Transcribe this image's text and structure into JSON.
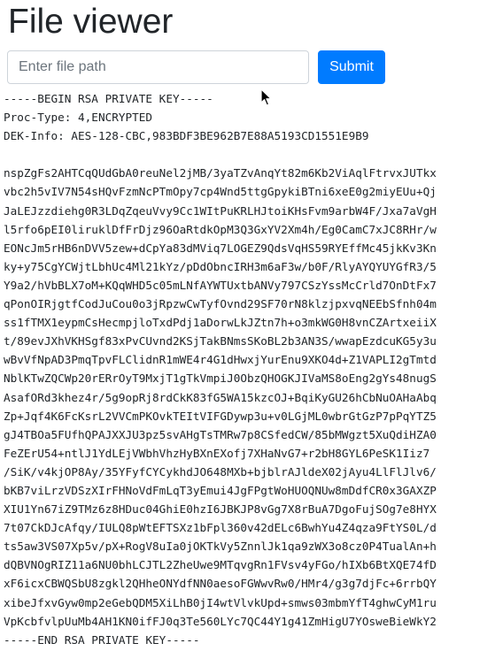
{
  "page": {
    "title": "File viewer"
  },
  "form": {
    "path_placeholder": "Enter file path",
    "path_value": "",
    "submit_label": "Submit"
  },
  "file": {
    "lines": [
      "-----BEGIN RSA PRIVATE KEY-----",
      "Proc-Type: 4,ENCRYPTED",
      "DEK-Info: AES-128-CBC,983BDF3BE962B7E88A5193CD1551E9B9",
      "",
      "nspZgFs2AHTCqQUdGbA0reuNel2jMB/3yaTZvAnqYt82m6Kb2ViAqlFtrvxJUTkx",
      "vbc2h5vIV7N54sHQvFzmNcPTmOpy7cp4Wnd5ttgGpykiBTni6xeE0g2miyEUu+Qj",
      "JaLEJzzdiehg0R3LDqZqeuVvy9Cc1WItPuKRLHJtoiKHsFvm9arbW4F/Jxa7aVgH",
      "l5rfo6pEI0liruklDfFrDjz96OaRtdkOpM3Q3GxYV2Xm4h/Eg0CamC7xJC8RHr/w",
      "EONcJm5rHB6nDVV5zew+dCpYa83dMViq7LOGEZ9QdsVqHS59RYEffMc45jkKv3Kn",
      "ky+y75CgYCWjtLbhUc4Ml21kYz/pDdObncIRH3m6aF3w/b0F/RlyAYQYUYGfR3/5",
      "Y9a2/hVbBLX7oM+KQqWHD5c05mLNfAYWTUxtbANVy797CSzYssMcCrld7OnDtFx7",
      "qPonOIRjgtfCodJuCou0o3jRpzwCwTyfOvnd29SF70rN8klzjpxvqNEEbSfnh04m",
      "ss1fTMX1eypmCsHecmpjloTxdPdj1aDorwLkJZtn7h+o3mkWG0H8vnCZArtxeiiX",
      "t/89evJXhVKHSgf83xPvCUvnd2KSjTakBNmsSKoBL2b3AN3S/wwapEzdcuKG5y3u",
      "wBvVfNpAD3PmqTpvFLClidnR1mWE4r4G1dHwxjYurEnu9XKO4d+Z1VAPLI2gTmtd",
      "NblKTwZQCWp20rERrOyT9MxjT1gTkVmpiJ0ObzQHOGKJIVaMS8oEng2gYs48nugS",
      "AsafORd3khez4r/5g9opRj8rdCkK83fG5WA15kzcOJ+BqiKyGU26hCbNuOAHaAbq",
      "Zp+Jqf4K6FcKsrL2VVCmPKOvkTEItVIFGDywp3u+v0LGjML0wbrGtGzP7pPqYTZ5",
      "gJ4TBOa5FUfhQPAJXXJU3pz5svAHgTsTMRw7p8CSfedCW/85bMWgzt5XuQdiHZA0",
      "FeZErU54+ntlJ1YdLEjVWbhVhzHyBXnEXofj7XHaNvG7+r2bH8GYL6PeSK1Iiz7",
      "/SiK/v4kjOP8Ay/35YFyfCYCykhdJO648MXb+bjblrAJldeX02jAyu4LlFlJlv6/",
      "bKB7viLrzVDSzXIrFHNoVdFmLqT3yEmui4JgFPgtWoHUOQNUw8mDdfCR0x3GAXZP",
      "XIU1Yn67iZ9TMz6z8HDuc04GhiE0hzI6JBKJP8vGg7X8rBuA7DgoFujSOg7e8HYX",
      "7t07CkDJcAfqy/IULQ8pWtEFTSXz1bFpl360v42dELc6BwhYu4Z4qza9FtYS0L/d",
      "ts5aw3VS07Xp5v/pX+RogV8uIa0jOKTkVy5ZnnlJk1qa9zWX3o8cz0P4TualAn+h",
      "dQBVNOgRIZ11a6NU0bhLCJTL2ZheUwe9MTqvgRn1FVsv4yFGo/hIXb6BtXQE74fD",
      "xF6icxCBWQSbU8zgkl2QHheONYdfNN0aesoFGWwvRw0/HMr4/g3g7djFc+6rrbQY",
      "xibeJfxvGyw0mp2eGebQDM5XiLhB0jI4wtVlvkUpd+smws03mbmYfT4ghwCyM1ru",
      "VpKcbfvlpUuMb4AH1KN0ifFJ0q3Te560LYc7QC44Y1g41ZmHigU7YOsweBieWkY2",
      "-----END RSA PRIVATE KEY-----"
    ]
  },
  "colors": {
    "primary": "#007bff",
    "text": "#212529",
    "input_border": "#ced4da",
    "placeholder": "#6c757d"
  },
  "icons": {
    "cursor": "mouse-pointer-icon"
  }
}
